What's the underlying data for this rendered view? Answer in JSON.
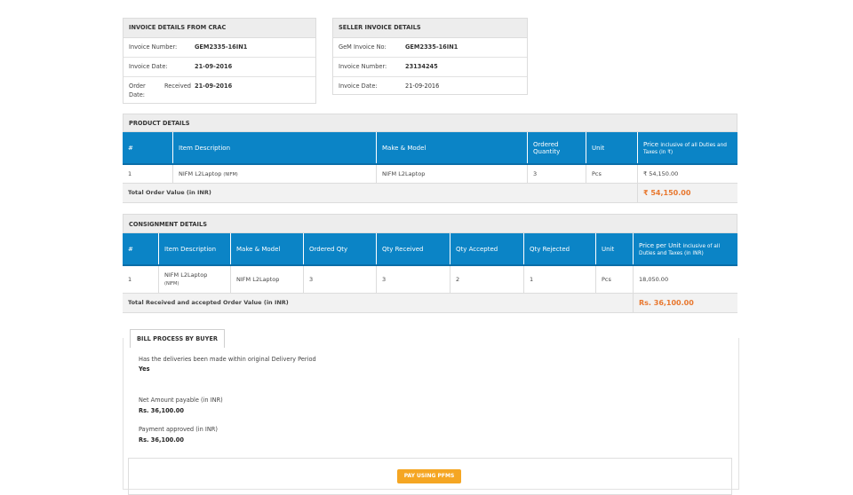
{
  "invoice_from_crac": {
    "title": "INVOICE DETAILS FROM CRAC",
    "rows": [
      {
        "label": "Invoice Number:",
        "value": "GEM2335-16IN1"
      },
      {
        "label": "Invoice Date:",
        "value": "21-09-2016"
      },
      {
        "label": "Order Received Date:",
        "value": "21-09-2016"
      }
    ]
  },
  "seller_invoice": {
    "title": "SELLER INVOICE DETAILS",
    "rows": [
      {
        "label": "GeM Invoice No:",
        "value": "GEM2335-16IN1"
      },
      {
        "label": "Invoice Number:",
        "value": "23134245"
      },
      {
        "label": "Invoice Date:",
        "value": "21-09-2016"
      }
    ]
  },
  "product_details": {
    "title": "PRODUCT DETAILS",
    "headers": {
      "num": "#",
      "item": "Item Description",
      "make": "Make & Model",
      "ordered_qty": "Ordered Quantity",
      "unit": "Unit",
      "price": "Price",
      "price_note": "inclusive of all Duties and Taxes (in ₹)"
    },
    "row": {
      "num": "1",
      "item": "NIFM L2Laptop",
      "item_note": "(NIFM)",
      "make": "NIFM L2Laptop",
      "qty": "3",
      "unit": "Pcs",
      "price": "₹ 54,150.00"
    },
    "total_label": "Total Order Value (in INR)",
    "total_value": "₹ 54,150.00"
  },
  "consignment_details": {
    "title": "CONSIGNMENT DETAILS",
    "headers": {
      "num": "#",
      "item": "Item Description",
      "make": "Make & Model",
      "ordered": "Ordered Qty",
      "received": "Qty Received",
      "accepted": "Qty Accepted",
      "rejected": "Qty Rejected",
      "unit": "Unit",
      "price": "Price per Unit",
      "price_note": "inclusive of all Duties and Taxes (in INR)"
    },
    "row": {
      "num": "1",
      "item": "NIFM L2Laptop",
      "item_note": "(NIFM)",
      "make": "NIFM L2Laptop",
      "ordered": "3",
      "received": "3",
      "accepted": "2",
      "rejected": "1",
      "unit": "Pcs",
      "price": "18,050.00"
    },
    "total_label": "Total Received and accepted Order Value (in INR)",
    "total_value": "Rs. 36,100.00"
  },
  "bill_process": {
    "tab_label": "BILL PROCESS BY BUYER",
    "q1": "Has the deliveries been made within original Delivery Period",
    "a1": "Yes",
    "q2": "Net Amount payable (in INR)",
    "a2": "Rs. 36,100.00",
    "q3": "Payment approved (in INR)",
    "a3": "Rs. 36,100.00",
    "button_label": "PAY USING PFMS"
  },
  "colors": {
    "table_header": "#0b84c6",
    "accent_orange": "#e8772e",
    "panel_header_bg": "#ededed",
    "button_bg": "#f5a623"
  }
}
